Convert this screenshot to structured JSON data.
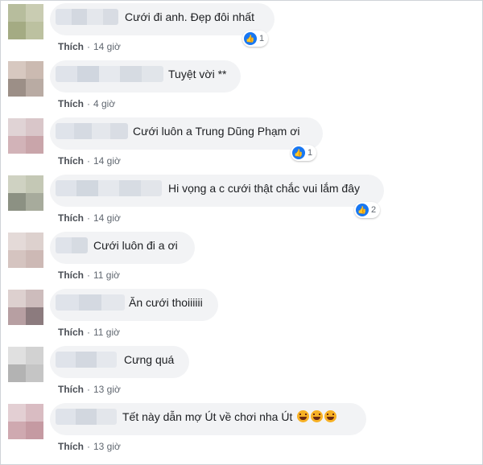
{
  "comments": [
    {
      "text": "Cưới đi anh. Đẹp đôi nhất",
      "like_label": "Thích",
      "time": "14 giờ",
      "reactions": "1",
      "emojis": []
    },
    {
      "text": "Tuyệt vời **",
      "like_label": "Thích",
      "time": "4 giờ",
      "reactions": null,
      "emojis": []
    },
    {
      "text": "Cưới luôn a Trung Dũng Phạm ơi",
      "like_label": "Thích",
      "time": "14 giờ",
      "reactions": "1",
      "emojis": []
    },
    {
      "text": "Hi vọng a c cưới thật chắc vui lắm đây",
      "like_label": "Thích",
      "time": "14 giờ",
      "reactions": "2",
      "emojis": []
    },
    {
      "text": "Cưới luôn đi a ơi",
      "like_label": "Thích",
      "time": "11 giờ",
      "reactions": null,
      "emojis": []
    },
    {
      "text": "Ăn cưới thoiiiiii",
      "like_label": "Thích",
      "time": "11 giờ",
      "reactions": null,
      "emojis": []
    },
    {
      "text": "Cưng quá",
      "like_label": "Thích",
      "time": "13 giờ",
      "reactions": null,
      "emojis": []
    },
    {
      "text": "Tết này dẫn mợ Út về chơi nha Út",
      "like_label": "Thích",
      "time": "13 giờ",
      "reactions": null,
      "emojis": [
        "laughing-emoji",
        "laughing-emoji",
        "laughing-emoji"
      ]
    }
  ],
  "icons": {
    "like_reaction": "like-icon",
    "separator": "·"
  },
  "colors": {
    "bubble": "#f2f3f5",
    "like_blue": "#1877f2",
    "meta_gray": "#606770"
  }
}
